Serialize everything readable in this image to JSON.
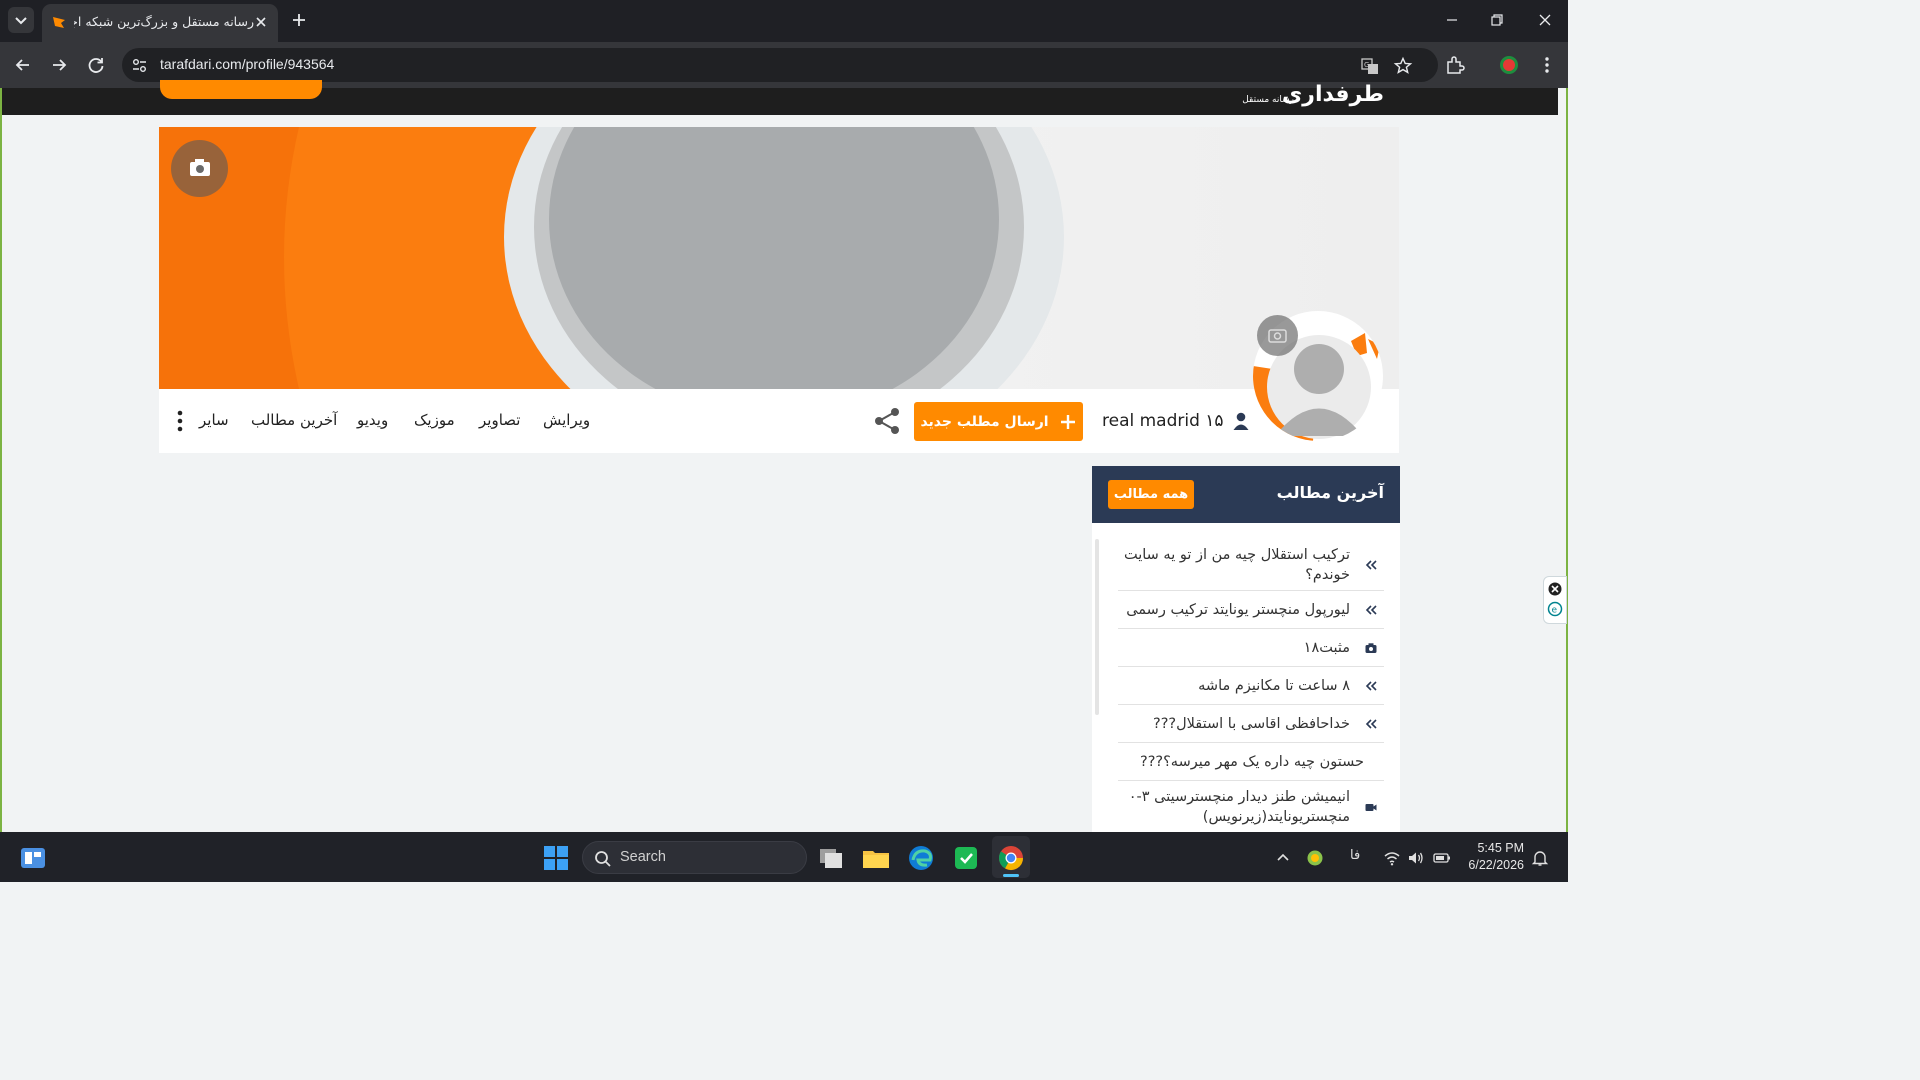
{
  "browser": {
    "tab_title": "رسانه مستقل و بزرگ‌ترین شبکه اجتماعی ورزشی",
    "url": "tarafdari.com/profile/943564"
  },
  "site": {
    "logo": "طرفداری",
    "logo_sub": "رسانه مستقل",
    "username": "real madrid ۱۵",
    "post_button": "ارسال مطلب جدید",
    "nav": {
      "edit": "ویرایش",
      "photos": "تصاویر",
      "music": "موزیک",
      "video": "ویدیو",
      "latest": "آخرین مطالب",
      "more": "سایر"
    },
    "widget": {
      "title": "آخرین مطالب",
      "all_button": "همه مطالب",
      "items": [
        {
          "text": "ترکیب استقلال چیه من از تو یه سایت خوندم؟",
          "icon": "double-chevron-icon"
        },
        {
          "text": "لیورپول منچستر یونایتد ترکیب رسمی",
          "icon": "double-chevron-icon"
        },
        {
          "text": "مثبت۱۸",
          "icon": "camera-icon"
        },
        {
          "text": "۸ ساعت تا مکانیزم ماشه",
          "icon": "double-chevron-icon"
        },
        {
          "text": "خداحافظی اقاسی با استقلال???",
          "icon": "double-chevron-icon"
        },
        {
          "text": "حستون چیه داره یک مهر میرسه؟???",
          "icon": ""
        },
        {
          "text": "انیمیشن طنز دیدار منچسترسیتی ۳-۰ منچستریونایتد(زیرنویس)",
          "icon": "video-icon"
        }
      ]
    }
  },
  "taskbar": {
    "search_label": "Search",
    "language": "فا",
    "time": "5:45 PM",
    "date": "6/22/2026"
  },
  "colors": {
    "brand_orange": "#ff8a00",
    "widget_header": "#2b3a55",
    "chrome_dark": "#35363a"
  }
}
